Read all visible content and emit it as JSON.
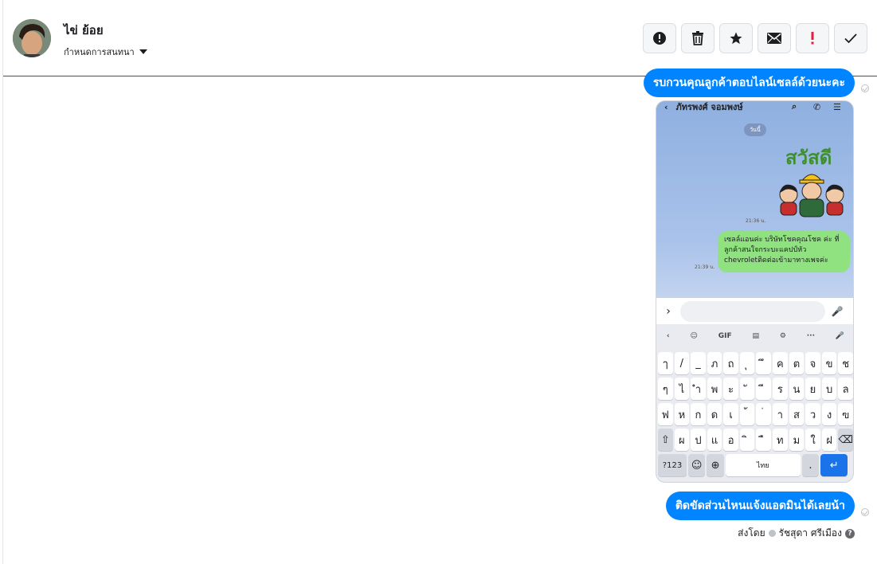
{
  "header": {
    "contact_name": "ไข่ ย้อย",
    "assign_label": "กำหนดการสนทนา",
    "toolbar": [
      {
        "name": "spam-button",
        "icon": "alert-circle-icon",
        "glyph": "!"
      },
      {
        "name": "delete-button",
        "icon": "trash-icon"
      },
      {
        "name": "star-button",
        "icon": "star-icon"
      },
      {
        "name": "mark-unread-button",
        "icon": "envelope-icon"
      },
      {
        "name": "priority-button",
        "icon": "exclamation-icon",
        "glyph": "!"
      },
      {
        "name": "done-button",
        "icon": "check-icon"
      }
    ]
  },
  "messages": {
    "first": "รบกวนคุณลูกค้าตอบไลน์เซลล์ด้วยนะคะ",
    "second": "ติดขัดส่วนไหนแจ้งแอดมินได้เลยน้า",
    "sent_by_label": "ส่งโดย",
    "sender_name": "รัชสุดา ศรีเมือง"
  },
  "screenshot": {
    "contact": "ภัทรพงศ์ จอมพงษ์",
    "day_label": "วันนี้",
    "sticker_text": "สวัสดี",
    "time_1": "21:36 น.",
    "time_2": "21:39 น.",
    "green_message": "เซลล์แอนค่ะ บริษัทโชคคุณโชค ค่ะ ที่ลูกค้าสนใจกระบะแคปป์หัว chevroletติดต่อเข้ามาทางเพจค่ะ",
    "keyboard": {
      "tools": [
        "‹",
        "☺",
        "GIF",
        "▤",
        "⚙",
        "···",
        "🎤"
      ],
      "rows": [
        [
          "ๅ",
          "/",
          "_",
          "ภ",
          "ถ",
          "ุ",
          "ึ",
          "ค",
          "ต",
          "จ",
          "ข",
          "ช"
        ],
        [
          "ๆ",
          "ไ",
          "ำ",
          "พ",
          "ะ",
          "ั",
          "ี",
          "ร",
          "น",
          "ย",
          "บ",
          "ล"
        ],
        [
          "ฟ",
          "ห",
          "ก",
          "ด",
          "เ",
          "้",
          "่",
          "า",
          "ส",
          "ว",
          "ง",
          "ฃ"
        ],
        [
          "⇧",
          "ผ",
          "ป",
          "แ",
          "อ",
          "ิ",
          "ื",
          "ท",
          "ม",
          "ใ",
          "ฝ",
          "⌫"
        ]
      ],
      "bottom": {
        "sym": "?123",
        "emoji": "☺",
        "globe": "⊕",
        "space": "ไทย",
        "period": ".",
        "enter": "↵"
      }
    }
  },
  "colors": {
    "accent": "#0084ff",
    "line_green": "#8fe27f"
  }
}
